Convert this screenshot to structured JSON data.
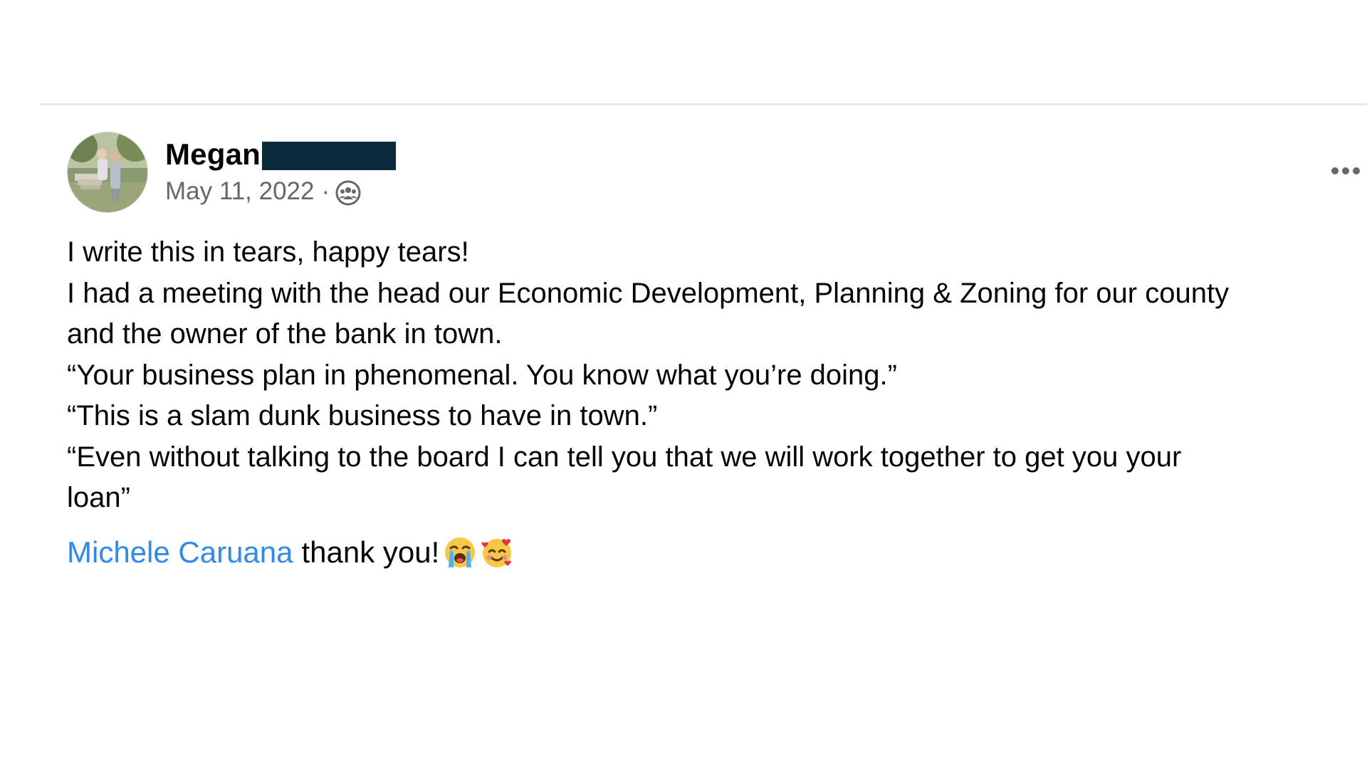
{
  "post": {
    "author": {
      "name": "Megan",
      "avatar_icon": "profile-photo"
    },
    "meta": {
      "date": "May 11, 2022",
      "separator": "·",
      "audience_icon": "group-audience-icon"
    },
    "body_lines": [
      "I write this in tears, happy tears!",
      "I had a meeting with the head our Economic Development, Planning & Zoning for our county",
      "and the owner of the bank in town.",
      "“Your business plan in phenomenal. You know what you’re doing.”",
      "“This is a slam dunk business to have in town.”",
      "“Even without talking to the board I can tell you that we will work together to get you your",
      "loan”"
    ],
    "mention": "Michele Caruana",
    "thanks": "thank you!",
    "emojis": [
      "loudly-crying-face-emoji",
      "smiling-face-with-hearts-emoji"
    ]
  },
  "colors": {
    "link": "#2e89f0",
    "redaction": "#0b2a3c",
    "meta": "#65676b",
    "divider": "#e6e7e9"
  }
}
